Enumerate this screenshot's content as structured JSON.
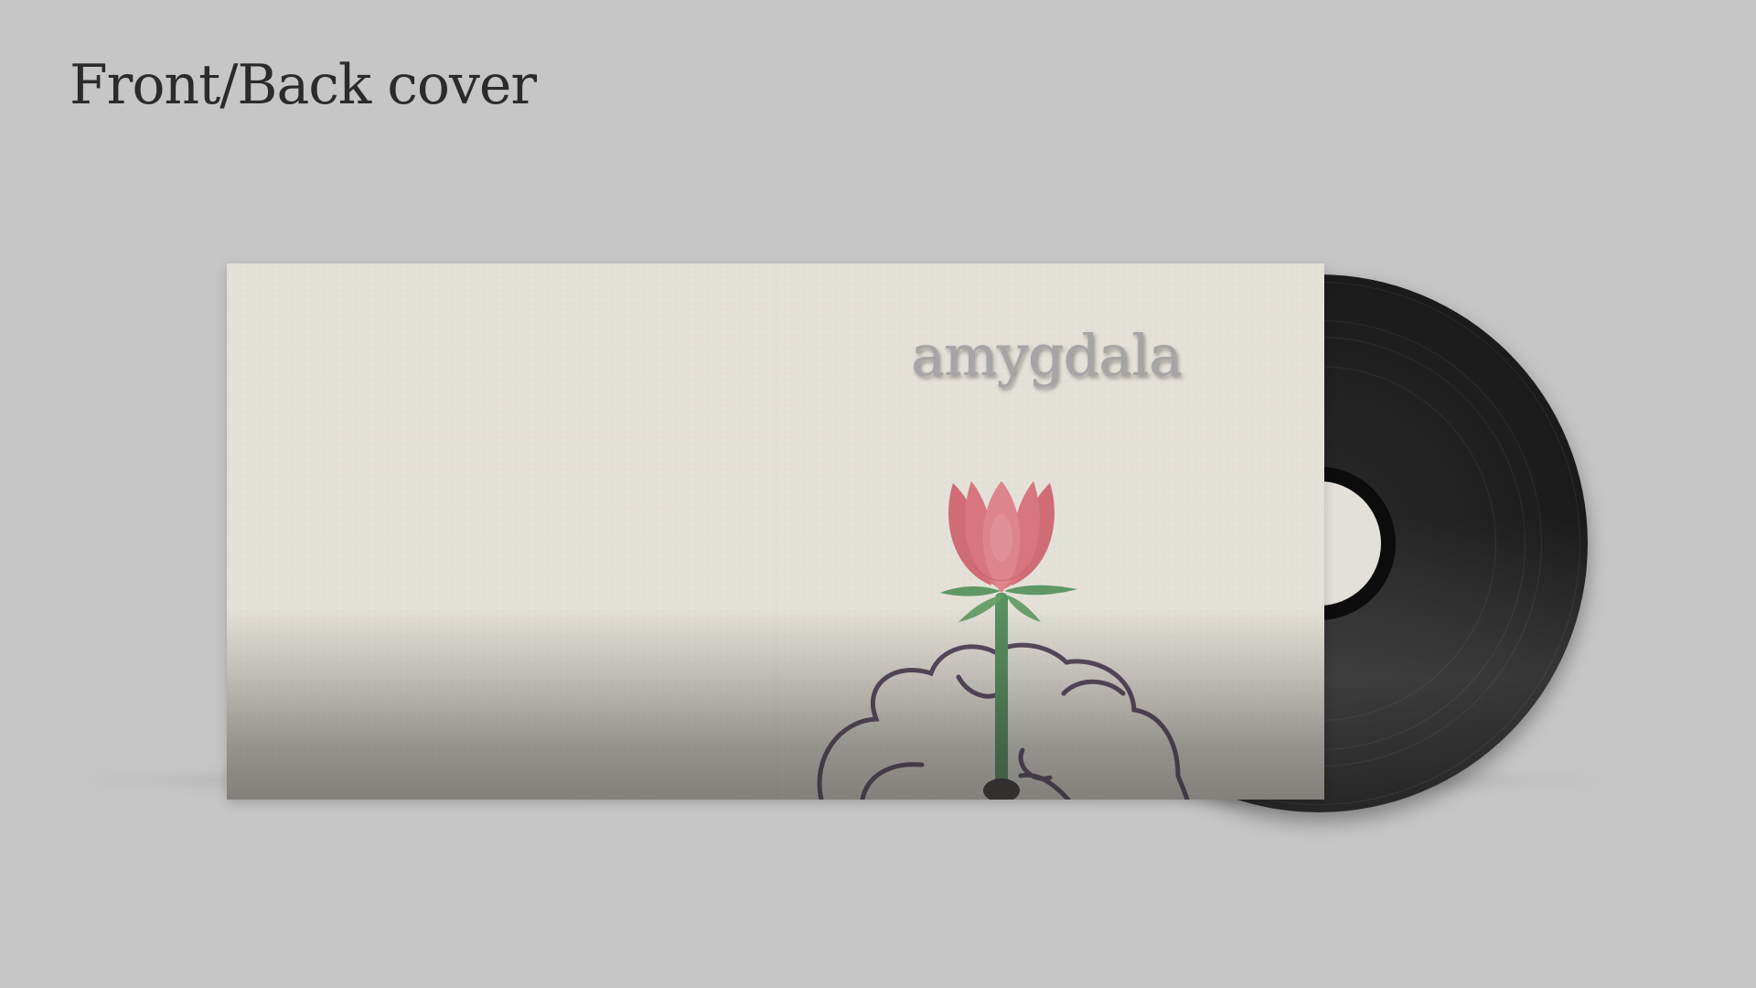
{
  "heading": "Front/Back cover",
  "album": {
    "title": "amygdala"
  },
  "colors": {
    "background": "#c6c6c6",
    "sleeve_paper": "#e4e1d8",
    "title_text": "#a5a5a5",
    "petal": "#d4737c",
    "petal_light": "#e08890",
    "stem": "#5a9160",
    "leaf": "#6a9f6c",
    "brain_outline": "#5a4a60",
    "vinyl": "#1d1d1d",
    "record_label": "#e2e0d8"
  },
  "icons": {
    "cover_art": "lotus-on-brain-illustration",
    "record": "vinyl-record"
  }
}
